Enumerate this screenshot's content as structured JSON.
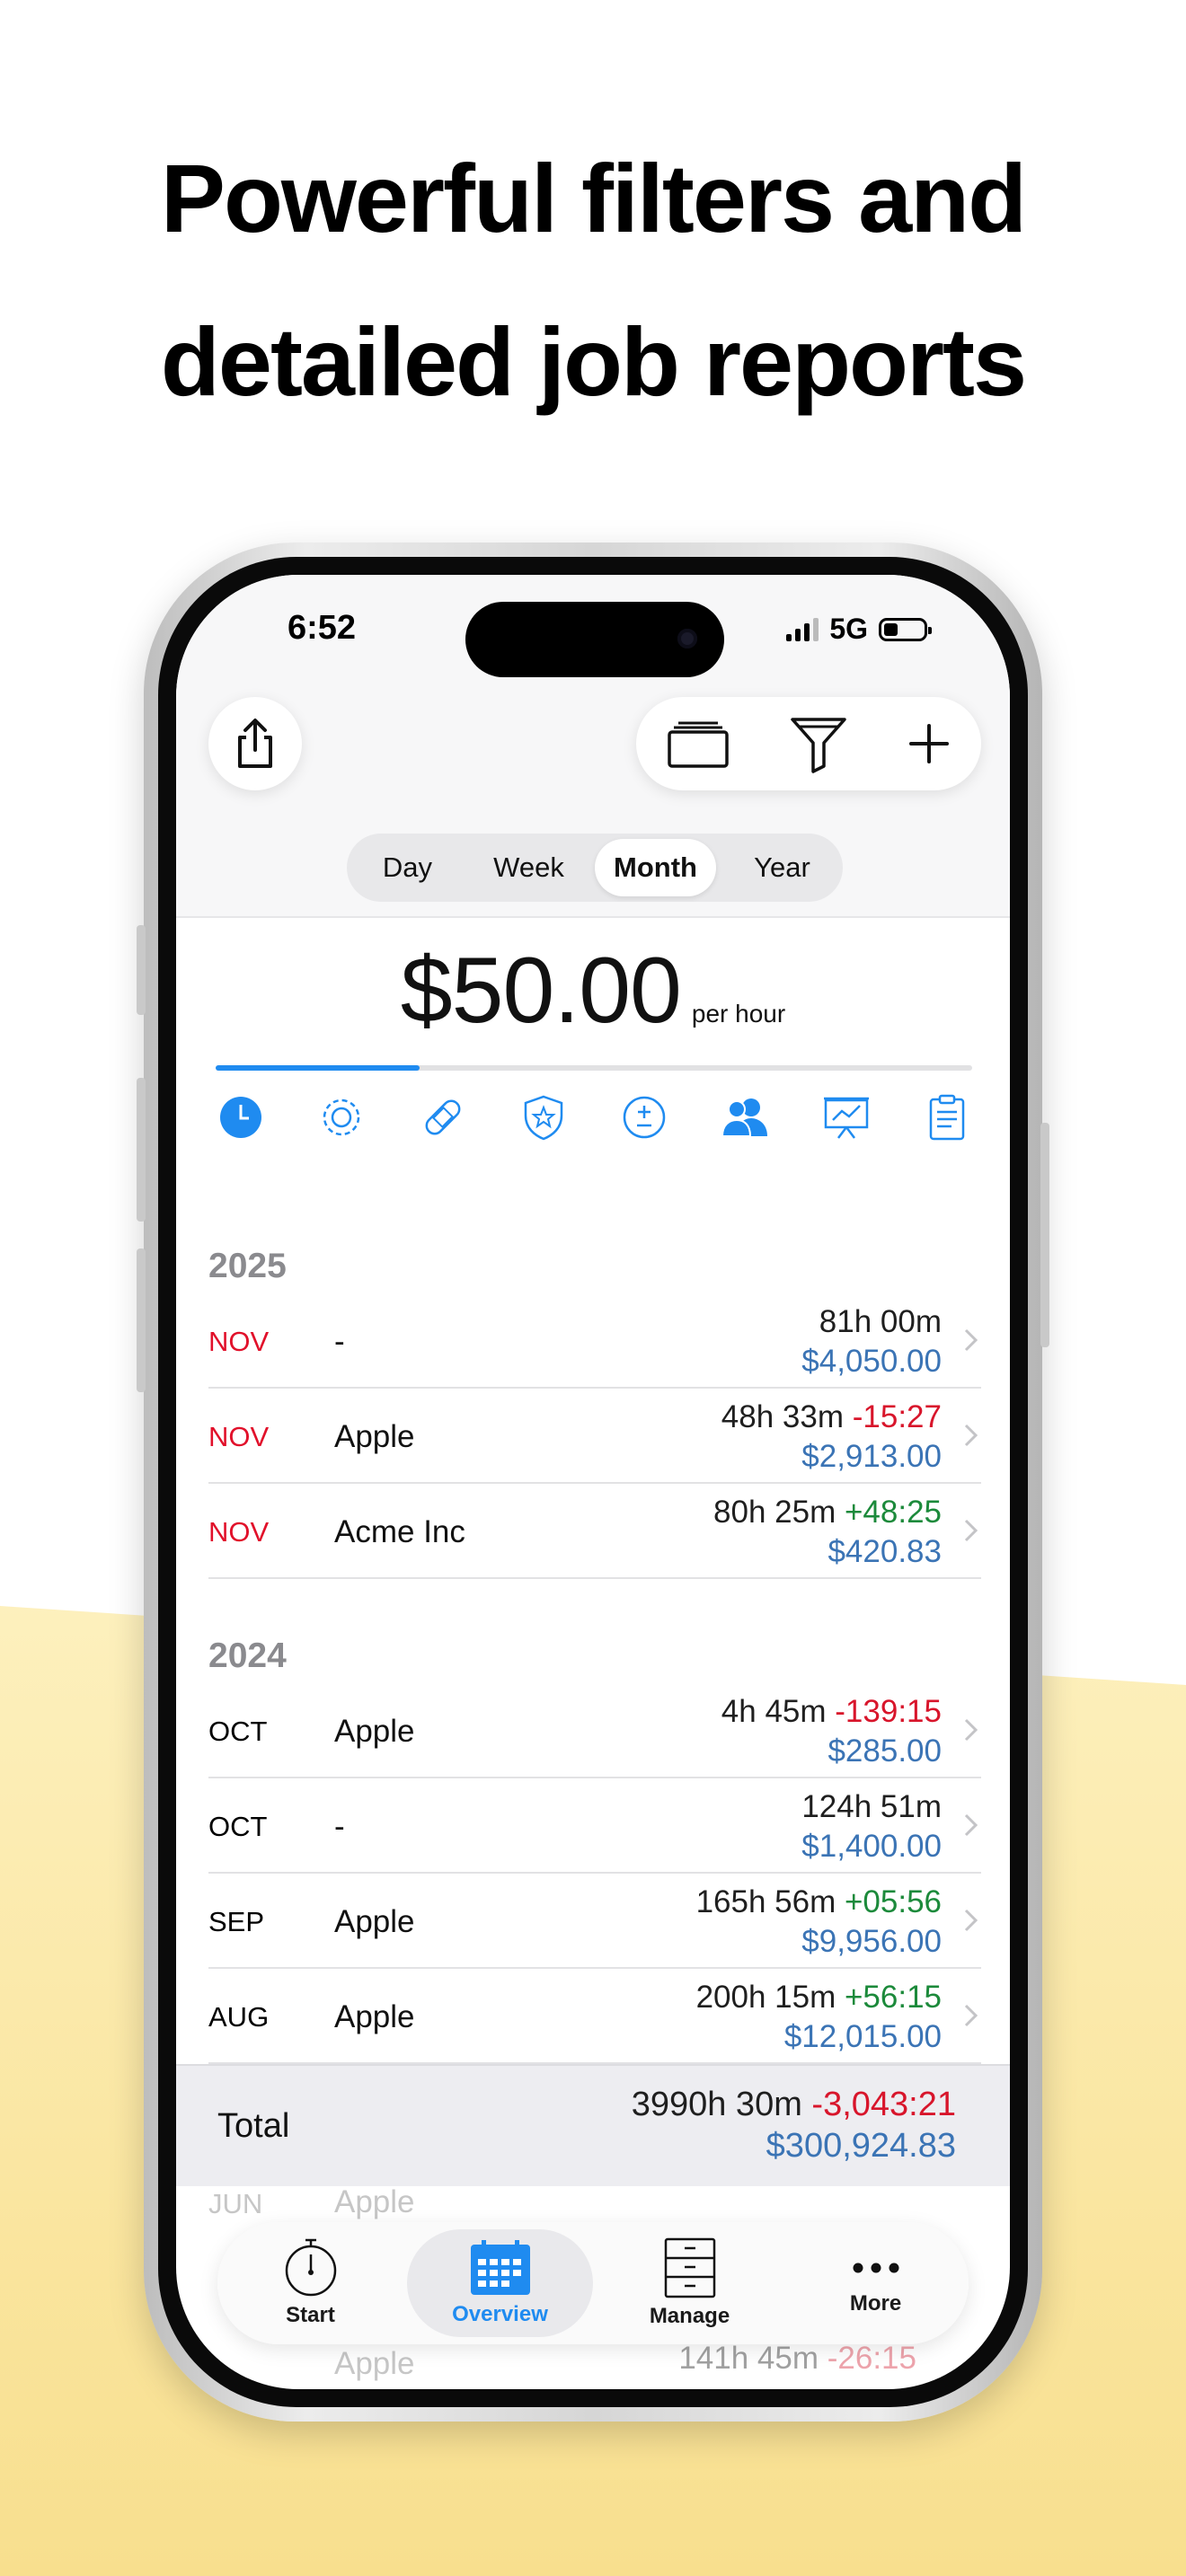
{
  "headline": {
    "line1": "Powerful filters and",
    "line2": "detailed job reports"
  },
  "status_bar": {
    "time": "6:52",
    "network": "5G",
    "battery_level": 0.35
  },
  "toolbar": {
    "share_icon": "share-icon",
    "folders_icon": "folders-icon",
    "filter_icon": "filter-icon",
    "add_icon": "plus-icon"
  },
  "period_tabs": [
    {
      "label": "Day",
      "selected": false
    },
    {
      "label": "Week",
      "selected": false
    },
    {
      "label": "Month",
      "selected": true
    },
    {
      "label": "Year",
      "selected": false
    }
  ],
  "rate": {
    "amount": "$50.00",
    "unit": "per hour",
    "progress": 0.27
  },
  "category_icons": [
    "clock-icon",
    "gear-icon",
    "bandage-icon",
    "shield-star-icon",
    "plus-minus-icon",
    "people-icon",
    "chart-presentation-icon",
    "clipboard-icon"
  ],
  "colors": {
    "accent": "#1f8bf0",
    "negative": "#d8152b",
    "positive": "#1c8a3b",
    "money": "#3b74b5",
    "month_red": "#e1102a"
  },
  "sections": [
    {
      "year": "2025",
      "rows": [
        {
          "month": "NOV",
          "name": "-",
          "hours": "81h 00m",
          "delta": "",
          "amount": "$4,050.00"
        },
        {
          "month": "NOV",
          "name": "Apple",
          "hours": "48h 33m",
          "delta": "-15:27",
          "amount": "$2,913.00"
        },
        {
          "month": "NOV",
          "name": "Acme Inc",
          "hours": "80h 25m",
          "delta": "+48:25",
          "amount": "$420.83"
        }
      ]
    },
    {
      "year": "2024",
      "rows": [
        {
          "month": "OCT",
          "name": "Apple",
          "hours": "4h 45m",
          "delta": "-139:15",
          "amount": "$285.00"
        },
        {
          "month": "OCT",
          "name": "-",
          "hours": "124h 51m",
          "delta": "",
          "amount": "$1,400.00"
        },
        {
          "month": "SEP",
          "name": "Apple",
          "hours": "165h 56m",
          "delta": "+05:56",
          "amount": "$9,956.00"
        },
        {
          "month": "AUG",
          "name": "Apple",
          "hours": "200h 15m",
          "delta": "+56:15",
          "amount": "$12,015.00"
        }
      ]
    }
  ],
  "total": {
    "label": "Total",
    "hours": "3990h 30m",
    "delta": "-3,043:21",
    "amount": "$300,924.83"
  },
  "behind_bar": {
    "row1": {
      "month": "JUN",
      "name": "Apple"
    },
    "row2_hours": "141h 45m",
    "row2_delta": "-26:15",
    "row3_name": "Apple"
  },
  "tabbar": [
    {
      "label": "Start",
      "icon": "stopwatch-icon",
      "active": false
    },
    {
      "label": "Overview",
      "icon": "calendar-icon",
      "active": true
    },
    {
      "label": "Manage",
      "icon": "cabinet-icon",
      "active": false
    },
    {
      "label": "More",
      "icon": "ellipsis-icon",
      "active": false
    }
  ]
}
